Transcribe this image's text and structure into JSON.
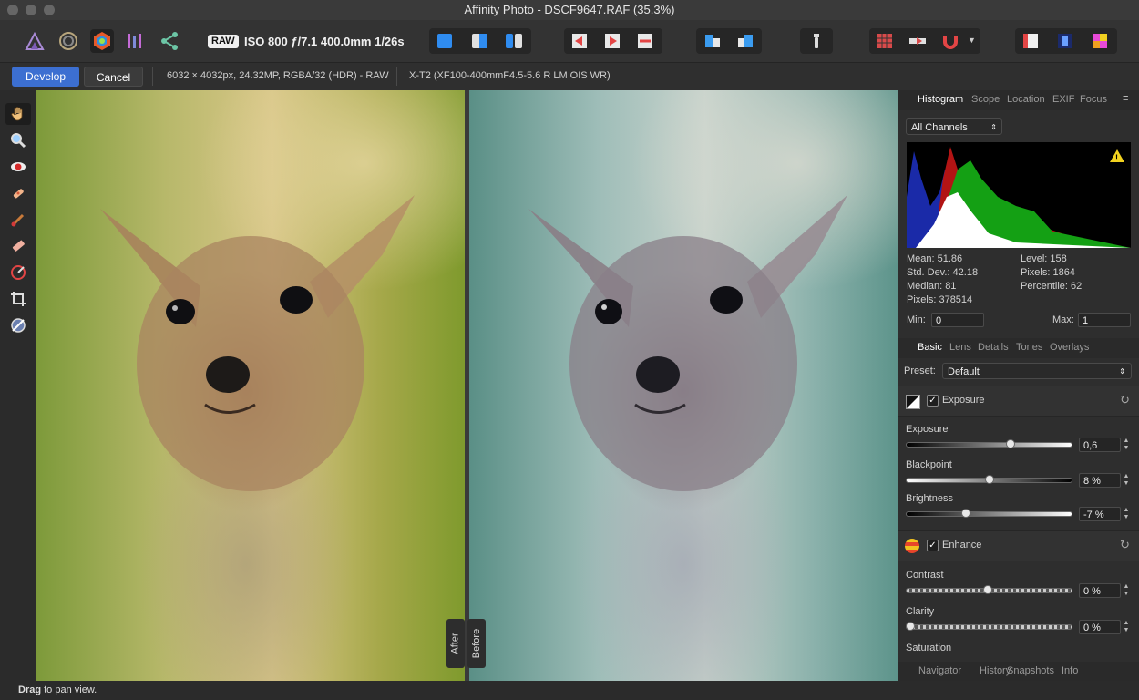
{
  "window": {
    "title": "Affinity Photo - DSCF9647.RAF (35.3%)"
  },
  "toolbar": {
    "raw_badge": "RAW",
    "exif_summary": "ISO 800 ƒ/7.1 400.0mm 1/26s"
  },
  "context": {
    "develop_label": "Develop",
    "cancel_label": "Cancel",
    "image_info": "6032 × 4032px, 24.32MP, RGBA/32 (HDR) - RAW",
    "camera_info": "X-T2 (XF100-400mmF4.5-5.6 R LM OIS WR)"
  },
  "canvas": {
    "after_label": "After",
    "before_label": "Before"
  },
  "histogram_panel": {
    "tabs": [
      "Histogram",
      "Scope",
      "Location",
      "EXIF",
      "Focus"
    ],
    "channel_select": "All Channels",
    "stats": {
      "mean": "Mean: 51.86",
      "std_dev": "Std. Dev.: 42.18",
      "median": "Median: 81",
      "pixels_left": "Pixels: 378514",
      "level": "Level: 158",
      "pixels_right": "Pixels: 1864",
      "percentile": "Percentile: 62"
    },
    "min_label": "Min:",
    "min_value": "0",
    "max_label": "Max:",
    "max_value": "1"
  },
  "adjust_panel": {
    "tabs": [
      "Basic",
      "Lens",
      "Details",
      "Tones",
      "Overlays"
    ],
    "preset_label": "Preset:",
    "preset_value": "Default",
    "exposure_section": {
      "title": "Exposure",
      "sliders": [
        {
          "label": "Exposure",
          "value": "0,6",
          "position": 0.63
        },
        {
          "label": "Blackpoint",
          "value": "8 %",
          "position": 0.5
        },
        {
          "label": "Brightness",
          "value": "-7 %",
          "position": 0.36
        }
      ]
    },
    "enhance_section": {
      "title": "Enhance",
      "sliders": [
        {
          "label": "Contrast",
          "value": "0 %",
          "position": 0.49
        },
        {
          "label": "Clarity",
          "value": "0 %",
          "position": 0.02
        }
      ],
      "next_label": "Saturation"
    }
  },
  "bottom_tabs": [
    "Navigator",
    "History",
    "Snapshots",
    "Info"
  ],
  "status": {
    "bold": "Drag",
    "rest": " to pan view."
  }
}
